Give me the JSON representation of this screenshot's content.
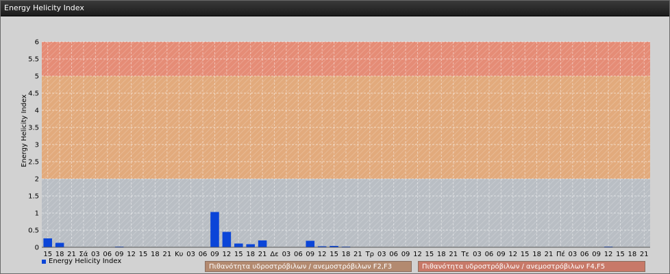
{
  "window": {
    "title": "Energy Helicity Index"
  },
  "legend": {
    "series_label": "Energy Helicity Index"
  },
  "risk_legend": [
    {
      "label": "Πιθανότητα υδροστρόβιλων / ανεμοστρόβιλων F2,F3",
      "color": "#b38a70"
    },
    {
      "label": "Πιθανότητα υδροστρόβιλων / ανεμοστρόβιλων F4,F5",
      "color": "#c87968"
    }
  ],
  "chart_data": {
    "type": "bar",
    "ylabel": "Energy Helicity Index",
    "ylim": [
      0,
      6
    ],
    "yticks": [
      "0",
      "0.5",
      "1",
      "1.5",
      "2",
      "2.5",
      "3",
      "3.5",
      "4",
      "4.5",
      "5",
      "5.5",
      "6"
    ],
    "bands": [
      {
        "from": 0,
        "to": 2,
        "color": "#b9bec4"
      },
      {
        "from": 2,
        "to": 5,
        "color": "#e2aa7c"
      },
      {
        "from": 5,
        "to": 6,
        "color": "#e58c76"
      }
    ],
    "grid": true,
    "categories": [
      "15",
      "18",
      "21",
      "Σά",
      "03",
      "06",
      "09",
      "12",
      "15",
      "18",
      "21",
      "Κυ",
      "03",
      "06",
      "09",
      "12",
      "15",
      "18",
      "21",
      "Δε",
      "03",
      "06",
      "09",
      "12",
      "15",
      "18",
      "21",
      "Τρ",
      "03",
      "06",
      "09",
      "12",
      "15",
      "18",
      "21",
      "Τε",
      "03",
      "06",
      "09",
      "12",
      "15",
      "18",
      "21",
      "Πέ",
      "03",
      "06",
      "09",
      "12",
      "15",
      "18",
      "21"
    ],
    "series": [
      {
        "name": "Energy Helicity Index",
        "color": "#0b45d8",
        "values": [
          0.26,
          0.13,
          0.01,
          0.01,
          0.01,
          0.01,
          0.02,
          0.01,
          0.01,
          0.01,
          0.01,
          0.01,
          0.01,
          0.01,
          1.03,
          0.45,
          0.11,
          0.09,
          0.2,
          0.01,
          0.01,
          0.01,
          0.19,
          0.03,
          0.04,
          0.02,
          0.01,
          0.01,
          0.01,
          0.01,
          0.01,
          0.01,
          0.01,
          0.01,
          0.01,
          0.01,
          0.01,
          0.01,
          0.01,
          0.01,
          0.01,
          0.01,
          0.01,
          0.01,
          0.01,
          0.01,
          0.01,
          0.02,
          0.01,
          0.01,
          0.01
        ]
      }
    ]
  }
}
